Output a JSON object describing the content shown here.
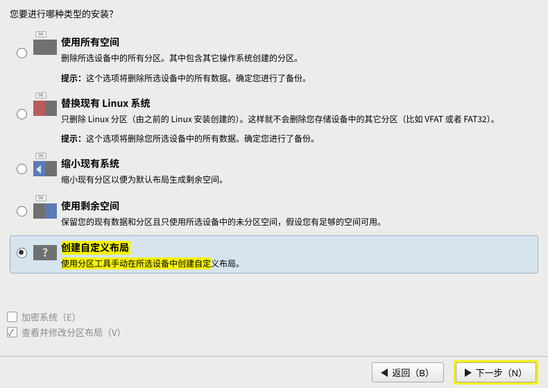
{
  "question": "您要进行哪种类型的安装？",
  "options": [
    {
      "title": "使用所有空间",
      "desc": "删除所选设备中的所有分区。其中包含其它操作系统创建的分区。",
      "tip_label": "提示：",
      "tip_text": "这个选项将删除所选设备中的所有数据。确定您进行了备份。"
    },
    {
      "title": "替换现有 Linux 系统",
      "desc": "只删除 Linux 分区（由之前的 Linux 安装创建的）。这样就不会删除您存储设备中的其它分区（比如 VFAT 或者 FAT32）。",
      "tip_label": "提示：",
      "tip_text": "这个选项将删除您所选设备中的所有数据。确定您进行了备份。"
    },
    {
      "title": "缩小现有系统",
      "desc": "缩小现有分区以便为默认布局生成剩余空间。"
    },
    {
      "title": "使用剩余空间",
      "desc": "保留您的现有数据和分区且只使用所选设备中的未分区空间，假设您有足够的空间可用。"
    },
    {
      "title": "创建自定义布局",
      "desc_hl": "使用分区工具手动在所选设备中创建自定",
      "desc_rest": "义布局。"
    }
  ],
  "checks": {
    "encrypt": "加密系统（E）",
    "review": "查看并修改分区布局（V）"
  },
  "buttons": {
    "back": "返回（B）",
    "next": "下一步（N）"
  },
  "icon_tab": "os"
}
